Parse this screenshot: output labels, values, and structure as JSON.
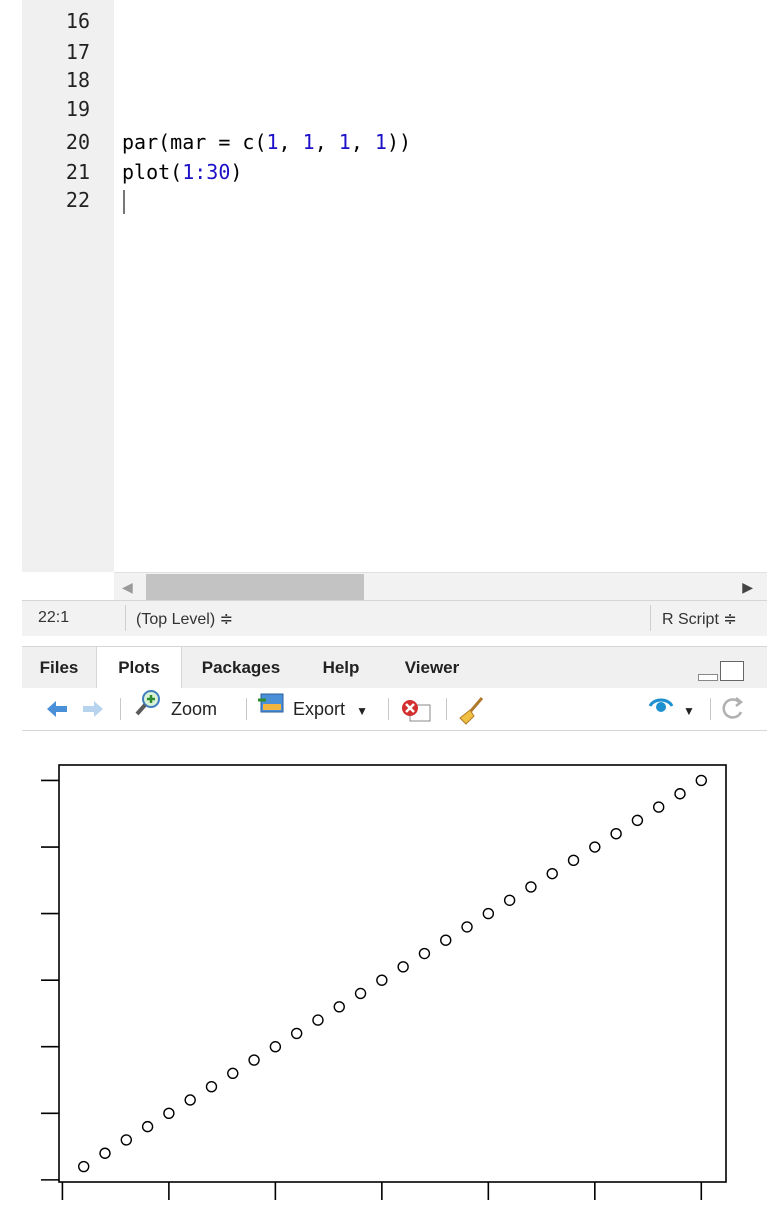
{
  "editor": {
    "line_numbers": [
      "16",
      "17",
      "18",
      "19",
      "20",
      "21",
      "22"
    ],
    "code_line_20": {
      "t1": "par(mar = c(",
      "n1": "1",
      ",": ", ",
      "n2": "1",
      "c2": ", ",
      "n3": "1",
      "c3": ", ",
      "n4": "1",
      "end": "))"
    },
    "code_line_21": {
      "t1": "plot(",
      "range": "1:30",
      "end": ")"
    }
  },
  "status": {
    "position": "22:1",
    "scope": "(Top Level) ≑",
    "filetype": "R Script ≑"
  },
  "tabs": [
    "Files",
    "Plots",
    "Packages",
    "Help",
    "Viewer"
  ],
  "active_tab": "Plots",
  "toolbar": {
    "zoom_label": "Zoom",
    "export_label": "Export",
    "icons": [
      "back-arrow-icon",
      "forward-arrow-icon",
      "zoom-icon",
      "export-icon",
      "remove-plot-icon",
      "clear-all-broom-icon",
      "publish-icon",
      "refresh-icon"
    ]
  },
  "chart_data": {
    "type": "scatter",
    "x": [
      1,
      2,
      3,
      4,
      5,
      6,
      7,
      8,
      9,
      10,
      11,
      12,
      13,
      14,
      15,
      16,
      17,
      18,
      19,
      20,
      21,
      22,
      23,
      24,
      25,
      26,
      27,
      28,
      29,
      30
    ],
    "y": [
      1,
      2,
      3,
      4,
      5,
      6,
      7,
      8,
      9,
      10,
      11,
      12,
      13,
      14,
      15,
      16,
      17,
      18,
      19,
      20,
      21,
      22,
      23,
      24,
      25,
      26,
      27,
      28,
      29,
      30
    ],
    "xlim": [
      1,
      30
    ],
    "ylim": [
      1,
      30
    ],
    "x_ticks": [
      0,
      5,
      10,
      15,
      20,
      25,
      30
    ],
    "y_ticks": [
      0,
      5,
      10,
      15,
      20,
      25,
      30
    ],
    "point_shape": "open-circle",
    "title": "",
    "xlabel": "",
    "ylabel": ""
  }
}
